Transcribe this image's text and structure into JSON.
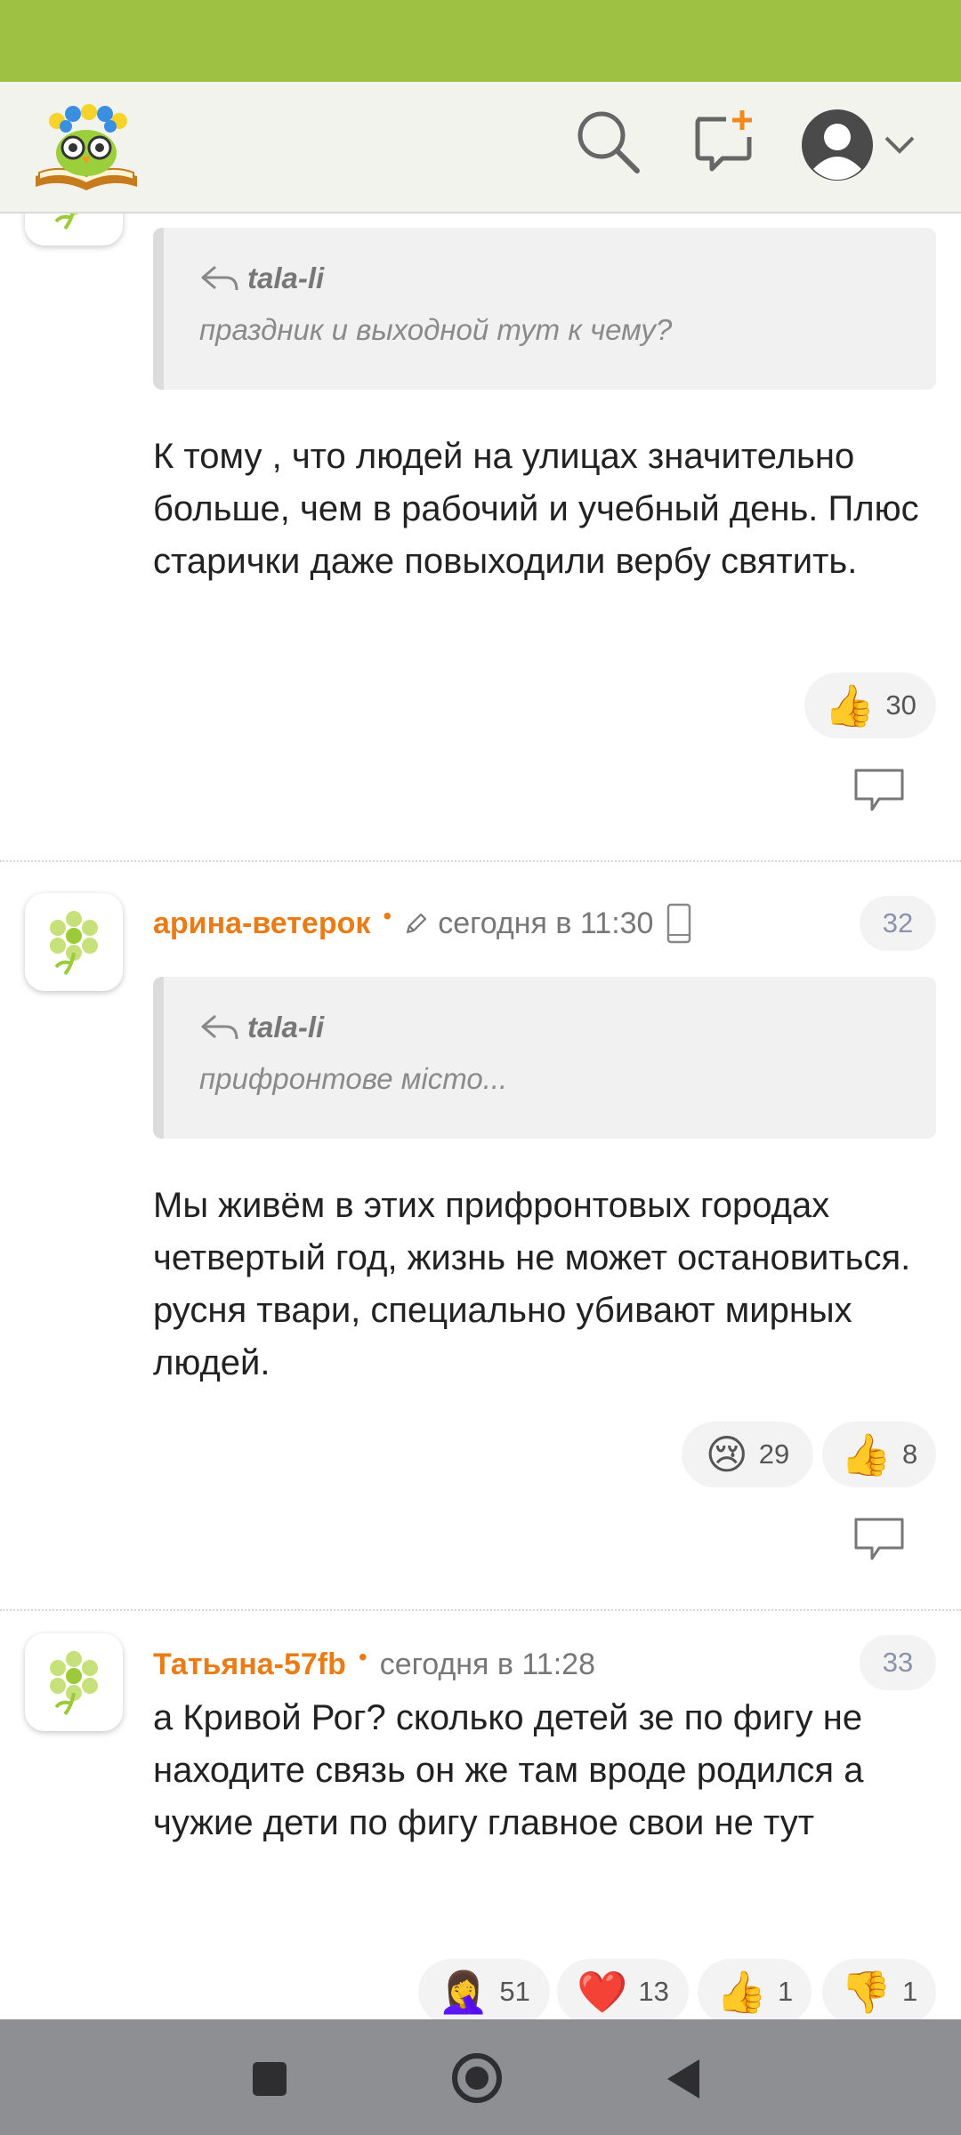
{
  "header": {
    "logo_name": "owl-book-logo",
    "icons": [
      "search-icon",
      "new-post-icon",
      "user-avatar-icon",
      "chevron-down-icon"
    ]
  },
  "comments": [
    {
      "quote": {
        "author": "tala-li",
        "text": "праздник и выходной тут к чему?"
      },
      "text": "К тому , что людей на улицах значительно больше, чем в рабочий и учебный день. Плюс старички даже повыходили вербу святить.",
      "reactions": [
        {
          "emoji": "👍",
          "count": "30"
        }
      ]
    },
    {
      "user": "арина-ветерок",
      "time": "сегодня в 11:30",
      "number": "32",
      "edited": true,
      "mobile": true,
      "quote": {
        "author": "tala-li",
        "text": "прифронтове місто..."
      },
      "text": "Мы живём в этих прифронтовых городах четвертый год, жизнь не может остановиться. русня твари, специально убивают мирных людей.",
      "reactions": [
        {
          "emoji": "😢",
          "count": "29"
        },
        {
          "emoji": "👍",
          "count": "8"
        }
      ]
    },
    {
      "user": "Татьяна-57fb",
      "time": "сегодня в 11:28",
      "number": "33",
      "text": "а Кривой Рог? сколько детей зе по фигу не находите связь он же там вроде родился а чужие дети по фигу главное свои не тут",
      "reactions": [
        {
          "emoji": "🤦‍♀️",
          "count": "51"
        },
        {
          "emoji": "❤️",
          "count": "13"
        },
        {
          "emoji": "👍",
          "count": "1"
        },
        {
          "emoji": "👎",
          "count": "1"
        }
      ]
    }
  ],
  "colors": {
    "status_bar": "#9fc143",
    "username": "#ea7c17",
    "nav_bar": "#8e8f93"
  }
}
